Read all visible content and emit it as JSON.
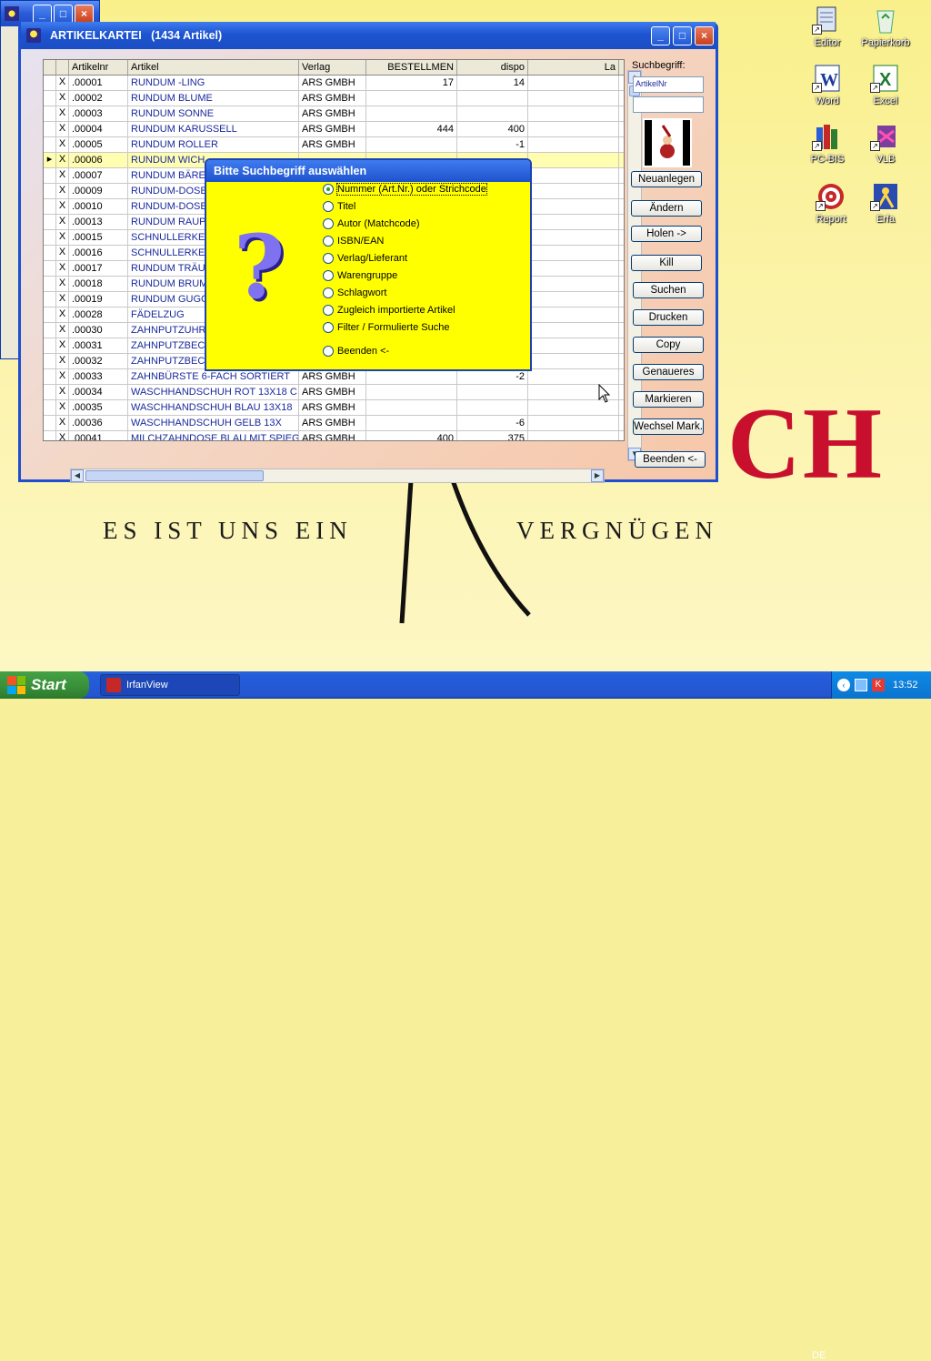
{
  "desktop": {
    "wallpaper_text": "CH",
    "slogan_left": "ES IST UNS EIN",
    "slogan_right": "VERGNÜGEN",
    "icons": [
      {
        "name": "editor",
        "label": "Editor"
      },
      {
        "name": "papierkorb",
        "label": "Papierkorb"
      },
      {
        "name": "word",
        "label": "Word"
      },
      {
        "name": "excel",
        "label": "Excel"
      },
      {
        "name": "pcbis",
        "label": "PC-BIS"
      },
      {
        "name": "vlb",
        "label": "VLB"
      },
      {
        "name": "report",
        "label": "Report"
      },
      {
        "name": "erfa",
        "label": "Erfa"
      }
    ]
  },
  "window": {
    "title": "ARTIKELKARTEI   (1434 Artikel)",
    "controls": {
      "min": "_",
      "max": "□",
      "close": "×"
    }
  },
  "grid": {
    "columns": [
      "",
      "",
      "Artikelnr",
      "Artikel",
      "Verlag",
      "BESTELLMEN",
      "dispo",
      "La"
    ],
    "rows": [
      {
        "mark": "",
        "x": "X",
        "nr": ".00001",
        "artikel": "RUNDUM -LING",
        "verlag": "ARS GMBH",
        "best": "17",
        "dispo": "14"
      },
      {
        "mark": "",
        "x": "X",
        "nr": ".00002",
        "artikel": "RUNDUM BLUME",
        "verlag": "ARS GMBH",
        "best": "",
        "dispo": ""
      },
      {
        "mark": "",
        "x": "X",
        "nr": ".00003",
        "artikel": "RUNDUM SONNE",
        "verlag": "ARS GMBH",
        "best": "",
        "dispo": ""
      },
      {
        "mark": "",
        "x": "X",
        "nr": ".00004",
        "artikel": "RUNDUM KARUSSELL",
        "verlag": "ARS GMBH",
        "best": "444",
        "dispo": "400"
      },
      {
        "mark": "",
        "x": "X",
        "nr": ".00005",
        "artikel": "RUNDUM ROLLER",
        "verlag": "ARS GMBH",
        "best": "",
        "dispo": "-1"
      },
      {
        "mark": "▸",
        "x": "X",
        "nr": ".00006",
        "artikel": "RUNDUM WICH",
        "verlag": "",
        "best": "",
        "dispo": ""
      },
      {
        "mark": "",
        "x": "X",
        "nr": ".00007",
        "artikel": "RUNDUM BÄRE",
        "verlag": "",
        "best": "",
        "dispo": ""
      },
      {
        "mark": "",
        "x": "X",
        "nr": ".00009",
        "artikel": "RUNDUM-DOSE",
        "verlag": "",
        "best": "",
        "dispo": ""
      },
      {
        "mark": "",
        "x": "X",
        "nr": ".00010",
        "artikel": "RUNDUM-DOSE",
        "verlag": "",
        "best": "",
        "dispo": ""
      },
      {
        "mark": "",
        "x": "X",
        "nr": ".00013",
        "artikel": "RUNDUM RAUP",
        "verlag": "",
        "best": "",
        "dispo": ""
      },
      {
        "mark": "",
        "x": "X",
        "nr": ".00015",
        "artikel": "SCHNULLERKET",
        "verlag": "",
        "best": "",
        "dispo": ""
      },
      {
        "mark": "",
        "x": "X",
        "nr": ".00016",
        "artikel": "SCHNULLERKET",
        "verlag": "",
        "best": "",
        "dispo": ""
      },
      {
        "mark": "",
        "x": "X",
        "nr": ".00017",
        "artikel": "RUNDUM TRÄU",
        "verlag": "",
        "best": "",
        "dispo": ""
      },
      {
        "mark": "",
        "x": "X",
        "nr": ".00018",
        "artikel": "RUNDUM BRUM",
        "verlag": "",
        "best": "",
        "dispo": ""
      },
      {
        "mark": "",
        "x": "X",
        "nr": ".00019",
        "artikel": "RUNDUM GUGG",
        "verlag": "",
        "best": "",
        "dispo": ""
      },
      {
        "mark": "",
        "x": "X",
        "nr": ".00028",
        "artikel": "FÄDELZUG",
        "verlag": "",
        "best": "",
        "dispo": ""
      },
      {
        "mark": "",
        "x": "X",
        "nr": ".00030",
        "artikel": "ZAHNPUTZUHR",
        "verlag": "",
        "best": "",
        "dispo": ""
      },
      {
        "mark": "",
        "x": "X",
        "nr": ".00031",
        "artikel": "ZAHNPUTZBEC",
        "verlag": "",
        "best": "",
        "dispo": ""
      },
      {
        "mark": "",
        "x": "X",
        "nr": ".00032",
        "artikel": "ZAHNPUTZBEC",
        "verlag": "",
        "best": "",
        "dispo": ""
      },
      {
        "mark": "",
        "x": "X",
        "nr": ".00033",
        "artikel": "ZAHNBÜRSTE 6-FACH SORTIERT",
        "verlag": "ARS GMBH",
        "best": "",
        "dispo": "-2"
      },
      {
        "mark": "",
        "x": "X",
        "nr": ".00034",
        "artikel": "WASCHHANDSCHUH ROT 13X18 C",
        "verlag": "ARS GMBH",
        "best": "",
        "dispo": ""
      },
      {
        "mark": "",
        "x": "X",
        "nr": ".00035",
        "artikel": "WASCHHANDSCHUH BLAU 13X18",
        "verlag": "ARS GMBH",
        "best": "",
        "dispo": ""
      },
      {
        "mark": "",
        "x": "X",
        "nr": ".00036",
        "artikel": "WASCHHANDSCHUH GELB 13X",
        "verlag": "ARS GMBH",
        "best": "",
        "dispo": "-6"
      },
      {
        "mark": "",
        "x": "X",
        "nr": ".00041",
        "artikel": "MILCHZAHNDOSE BLAU MIT SPIEGI",
        "verlag": "ARS GMBH",
        "best": "400",
        "dispo": "375"
      }
    ]
  },
  "panel": {
    "suchbegriff_label": "Suchbegriff:",
    "suchbegriff_value": "ArtikelNr",
    "search_value": "",
    "buttons": [
      "Neuanlegen",
      "Ändern",
      "Holen ->",
      "Kill",
      "Suchen",
      "Drucken",
      "Copy",
      "Genaueres",
      "Markieren",
      "Wechsel Mark.",
      "Beenden <-"
    ]
  },
  "dialog": {
    "title": "Bitte Suchbegriff auswählen",
    "selected_index": 0,
    "options": [
      "Nummer (Art.Nr.) oder Strichcode",
      "Titel",
      "Autor (Matchcode)",
      "ISBN/EAN",
      "Verlag/Lieferant",
      "Warengruppe",
      "Schlagwort",
      "Zugleich importierte Artikel",
      "Filter / Formulierte Suche",
      "Beenden <-"
    ]
  },
  "taskbar": {
    "start_label": "Start",
    "task_label": "IrfanView",
    "lang": "DE",
    "clock": "13:52"
  },
  "colors": {
    "accent": "#1e4fcf",
    "dialog_bg": "#ffff00",
    "wallpaper_red": "#c8102e",
    "selected_row": "#fffdb0"
  }
}
